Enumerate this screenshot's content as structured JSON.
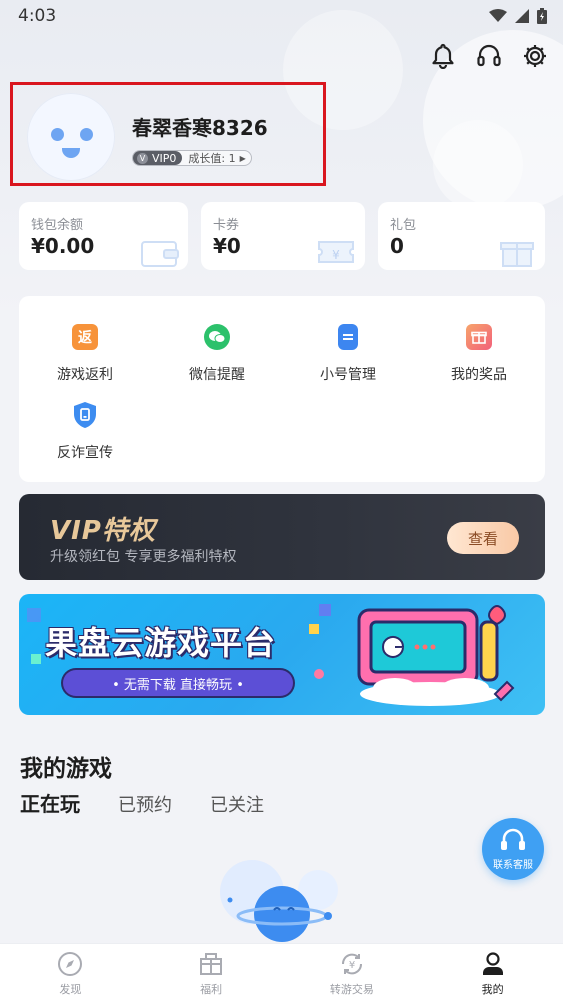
{
  "status_bar": {
    "time": "4:03"
  },
  "profile": {
    "username": "春翠香寒8326",
    "vip_level": "VIP0",
    "vip_letter": "V",
    "growth": "成长值: 1"
  },
  "wallet": [
    {
      "label": "钱包余额",
      "value": "¥0.00"
    },
    {
      "label": "卡券",
      "value": "¥0"
    },
    {
      "label": "礼包",
      "value": "0"
    }
  ],
  "menu": [
    {
      "label": "游戏返利",
      "icon": "rebate-icon",
      "glyph": "返",
      "color": "#f7933a"
    },
    {
      "label": "微信提醒",
      "icon": "wechat-icon",
      "glyph": "",
      "color": "#2cc16b"
    },
    {
      "label": "小号管理",
      "icon": "clipboard-icon",
      "glyph": "",
      "color": "#3d86f0"
    },
    {
      "label": "我的奖品",
      "icon": "gift-icon",
      "glyph": "",
      "color": "#f2607a"
    },
    {
      "label": "反诈宣传",
      "icon": "shield-icon",
      "glyph": "",
      "color": "#3d8cf0"
    }
  ],
  "vip_banner": {
    "title": "VIP特权",
    "subtitle": "升级领红包 专享更多福利特权",
    "button": "查看"
  },
  "cloud_banner": {
    "title": "果盘云游戏平台",
    "pill": "•  无需下载  直接畅玩  •"
  },
  "my_games": {
    "title": "我的游戏",
    "tabs": [
      "正在玩",
      "已预约",
      "已关注"
    ],
    "active_tab": "正在玩"
  },
  "support": {
    "label": "联系客服"
  },
  "bottom_nav": [
    {
      "label": "发现",
      "icon": "compass-icon"
    },
    {
      "label": "福利",
      "icon": "welfare-icon"
    },
    {
      "label": "转游交易",
      "icon": "exchange-icon"
    },
    {
      "label": "我的",
      "icon": "user-icon",
      "active": true
    }
  ]
}
